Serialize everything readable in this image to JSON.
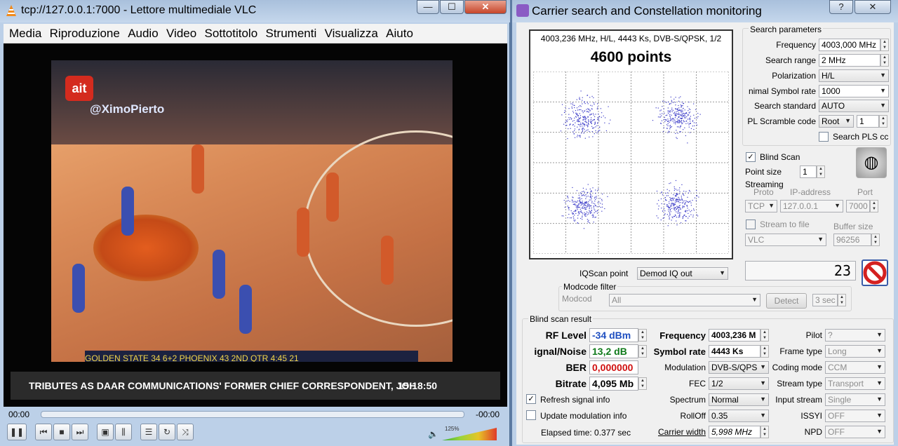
{
  "vlc": {
    "title": "tcp://127.0.0.1:7000 - Lettore multimediale VLC",
    "menu": [
      "Media",
      "Riproduzione",
      "Audio",
      "Video",
      "Sottotitolo",
      "Strumenti",
      "Visualizza",
      "Aiuto"
    ],
    "overlay_logo": "ait",
    "overlay_handle": "@XimoPierto",
    "scoreboard": "GOLDEN STATE  34  6+2      PHOENIX  43  2ND QTR  4:45  21",
    "ticker": "TRIBUTES AS DAAR COMMUNICATIONS' FORMER CHIEF CORRESPONDENT, JOH",
    "ticker_clock": "15:18:50",
    "time_elapsed": "00:00",
    "time_remaining": "-00:00",
    "volume_label": "125%",
    "volume_level": 1.0,
    "seek_position": 0.0,
    "window_buttons": {
      "minimize": "—",
      "maximize": "☐",
      "close": "✕"
    }
  },
  "cs": {
    "title": "Carrier search and Constellation monitoring",
    "help_button": "?",
    "close_button": "✕",
    "plot_header": "4003,236 MHz, H/L, 4443 Ks, DVB-S/QPSK, 1/2",
    "plot_points": "4600 points",
    "search_params": {
      "label": "Search parameters",
      "frequency_label": "Frequency",
      "frequency_value": "4003,000 MHz",
      "range_label": "Search range",
      "range_value": "2 MHz",
      "polarization_label": "Polarization",
      "polarization_value": "H/L",
      "minsr_label": "nimal Symbol rate",
      "minsr_value": "1000",
      "standard_label": "Search standard",
      "standard_value": "AUTO",
      "pls_label": "PL Scramble code",
      "pls_mode": "Root",
      "pls_value": "1",
      "search_pls_label": "Search PLS cc"
    },
    "blind_scan_label": "Blind Scan",
    "blind_scan_checked": true,
    "point_size_label": "Point size",
    "point_size_value": "1",
    "streaming": {
      "label": "Streaming",
      "proto_label": "Proto",
      "proto_value": "TCP",
      "ip_label": "IP-address",
      "ip_value": "127.0.0.1",
      "port_label": "Port",
      "port_value": "7000",
      "stream_to_file_label": "Stream to file",
      "buffer_label": "Buffer size",
      "buffer_value": "96256",
      "player_value": "VLC"
    },
    "iqscan_label": "IQScan point",
    "iqscan_value": "Demod IQ out",
    "lcd_value": "23",
    "modcode_filter_label": "Modcode filter",
    "modcode_label": "Modcod",
    "modcode_value": "All",
    "detect_button": "Detect",
    "detect_time": "3 sec",
    "result": {
      "label": "Blind scan result",
      "rf_label": "RF Level",
      "rf_value": "-34 dBm",
      "snr_label": "ignal/Noise",
      "snr_value": "13,2 dB",
      "ber_label": "BER",
      "ber_value": "0,000000",
      "bitrate_label": "Bitrate",
      "bitrate_value": "4,095 Mb",
      "freq_label": "Frequency",
      "freq_value": "4003,236 M",
      "sr_label": "Symbol rate",
      "sr_value": "4443 Ks",
      "mod_label": "Modulation",
      "mod_value": "DVB-S/QPS",
      "fec_label": "FEC",
      "fec_value": "1/2",
      "spectrum_label": "Spectrum",
      "spectrum_value": "Normal",
      "rolloff_label": "RollOff",
      "rolloff_value": "0.35",
      "carrier_width_label": "Carrier width",
      "carrier_width_value": "5,998 MHz",
      "pilot_label": "Pilot",
      "pilot_value": "?",
      "frame_label": "Frame type",
      "frame_value": "Long",
      "coding_label": "Coding mode",
      "coding_value": "CCM",
      "stream_type_label": "Stream type",
      "stream_type_value": "Transport",
      "input_stream_label": "Input stream",
      "input_stream_value": "Single",
      "issyi_label": "ISSYI",
      "issyi_value": "OFF",
      "npd_label": "NPD",
      "npd_value": "OFF"
    },
    "refresh_label": "Refresh signal info",
    "refresh_checked": true,
    "update_mod_label": "Update modulation info",
    "update_mod_checked": false,
    "elapsed_label": "Elapsed time: 0.377 sec",
    "colors": {
      "rf": "#1f4fc0",
      "snr": "#0f7a1a",
      "ber": "#d01010",
      "points": "#3c3cc8"
    }
  }
}
